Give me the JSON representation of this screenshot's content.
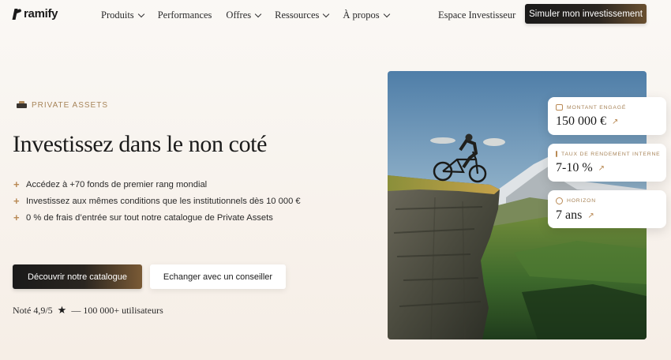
{
  "brand": {
    "name": "ramify"
  },
  "nav": {
    "items": [
      {
        "label": "Produits",
        "has_dropdown": true
      },
      {
        "label": "Performances",
        "has_dropdown": false
      },
      {
        "label": "Offres",
        "has_dropdown": true
      },
      {
        "label": "Ressources",
        "has_dropdown": true
      },
      {
        "label": "À propos",
        "has_dropdown": true
      }
    ],
    "espace_label": "Espace Investisseur",
    "cta_label": "Simuler mon investissement"
  },
  "hero": {
    "tag": "PRIVATE ASSETS",
    "title": "Investissez dans le non coté",
    "bullets": [
      "Accédez à +70 fonds de premier rang mondial",
      "Investissez aux mêmes conditions que les institutionnels dès 10 000 €",
      "0 % de frais d’entrée sur tout notre catalogue de Private Assets"
    ],
    "primary_button": "Découvrir notre catalogue",
    "secondary_button": "Echanger avec un conseiller",
    "rating_prefix": "Noté 4,9/5",
    "rating_suffix": "— 100 000+ utilisateurs"
  },
  "stats": [
    {
      "label": "MONTANT ENGAGÉ",
      "value": "150 000 €",
      "icon": "wallet-icon"
    },
    {
      "label": "TAUX DE RENDEMENT INTERNE",
      "value": "7-10 %",
      "icon": "exchange-icon"
    },
    {
      "label": "HORIZON",
      "value": "7 ans",
      "icon": "clock-icon"
    }
  ],
  "colors": {
    "accent": "#b98a55",
    "dark": "#1a1a1a"
  }
}
